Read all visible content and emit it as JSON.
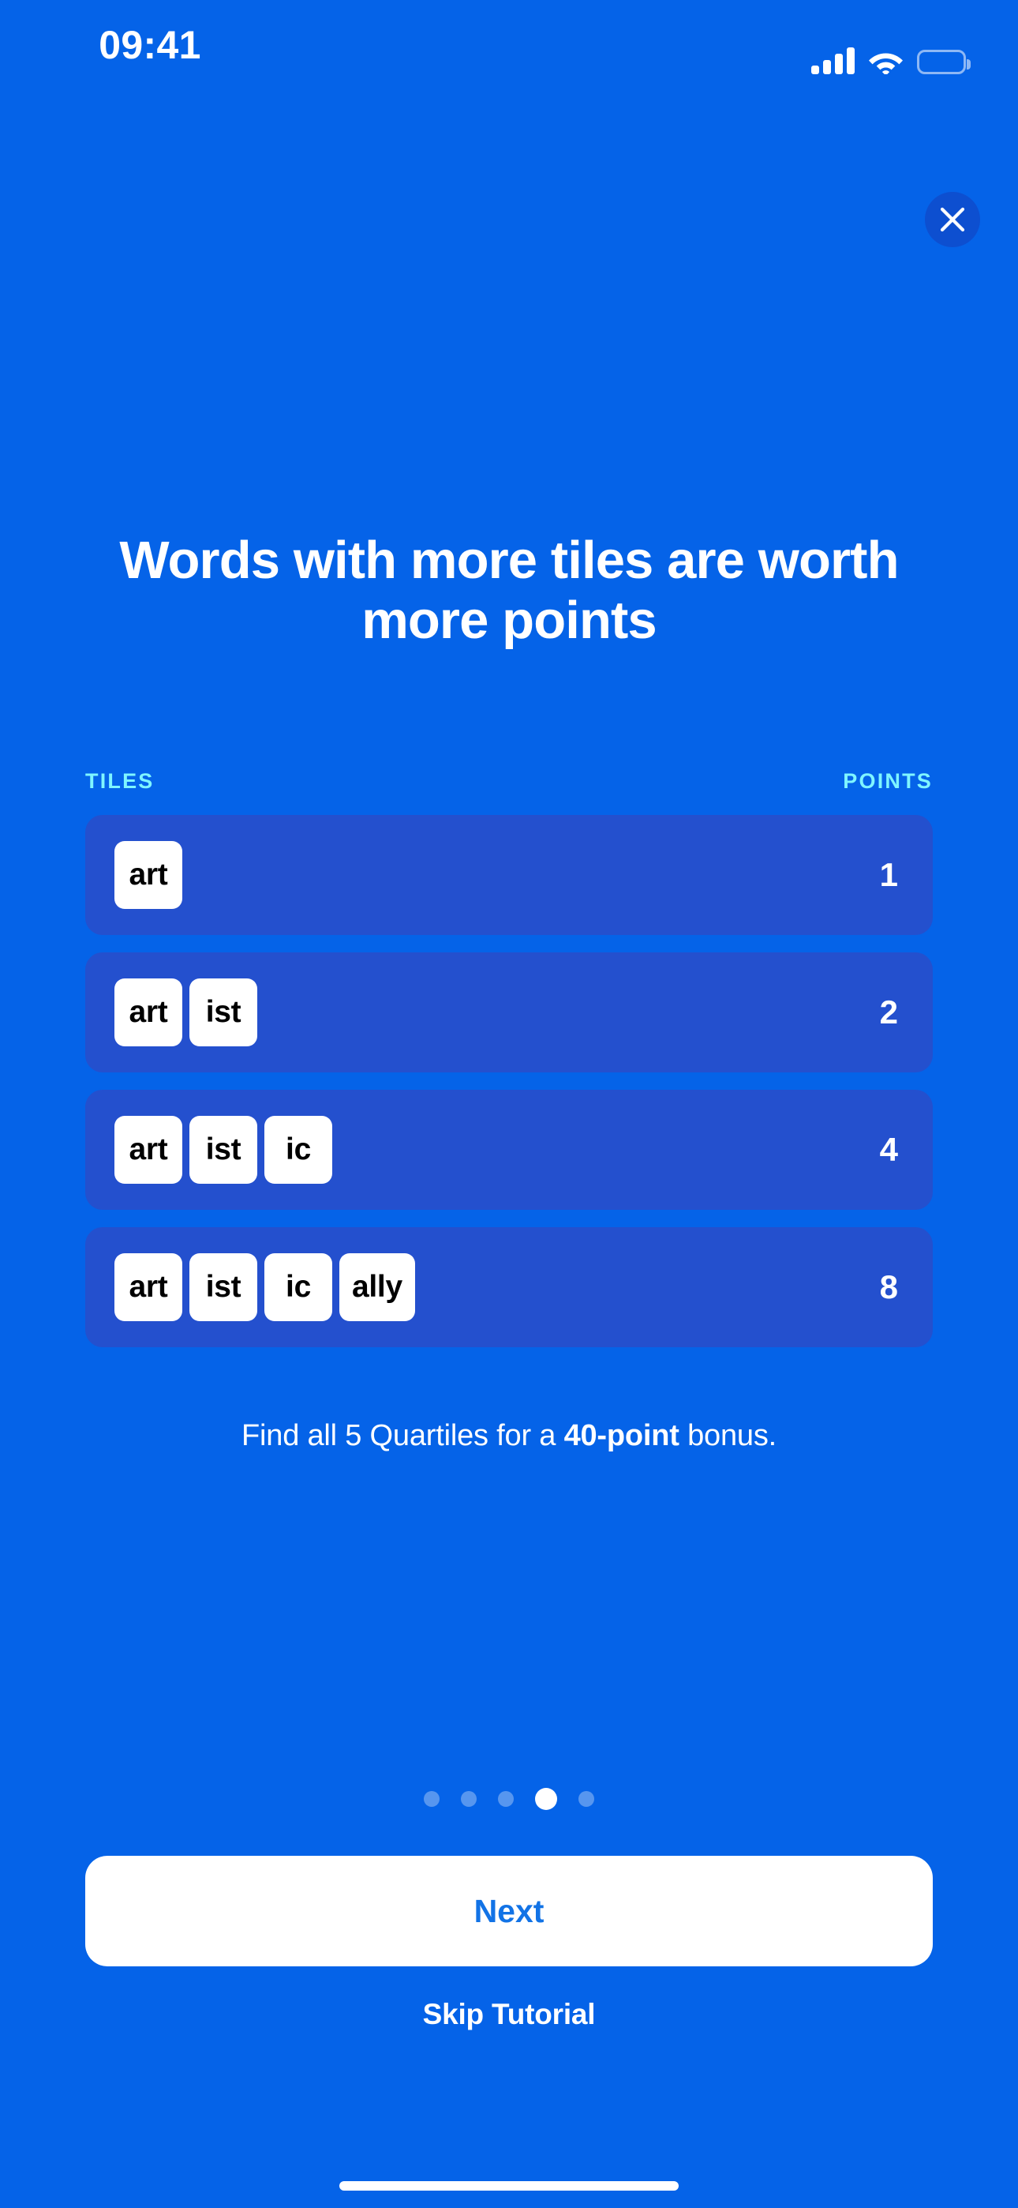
{
  "theme": {
    "background": "#0563E8",
    "row_background": "#2450CE",
    "accent_cyan": "#7FF5FF",
    "tile_background": "#FFFFFF",
    "tile_text": "#000000",
    "button_text": "#1273E6",
    "close_button_background": "#0D4FD0"
  },
  "status_bar": {
    "time": "09:41",
    "cellular_icon": "cellular-signal-icon",
    "wifi_icon": "wifi-icon",
    "battery_icon": "battery-full-icon"
  },
  "header": {
    "close_icon": "close-icon"
  },
  "tutorial": {
    "heading": "Words with more tiles are worth more points",
    "columns": {
      "tiles": "TILES",
      "points": "POINTS"
    },
    "rows": [
      {
        "tiles": [
          "art"
        ],
        "points": "1"
      },
      {
        "tiles": [
          "art",
          "ist"
        ],
        "points": "2"
      },
      {
        "tiles": [
          "art",
          "ist",
          "ic"
        ],
        "points": "4"
      },
      {
        "tiles": [
          "art",
          "ist",
          "ic",
          "ally"
        ],
        "points": "8"
      }
    ],
    "bonus_text": {
      "prefix": "Find all 5 Quartiles for a ",
      "emphasis": "40-point",
      "suffix": " bonus."
    }
  },
  "pagination": {
    "total": 5,
    "active_index": 3
  },
  "footer": {
    "next_label": "Next",
    "skip_label": "Skip Tutorial"
  },
  "system": {
    "home_indicator": "home-indicator"
  }
}
